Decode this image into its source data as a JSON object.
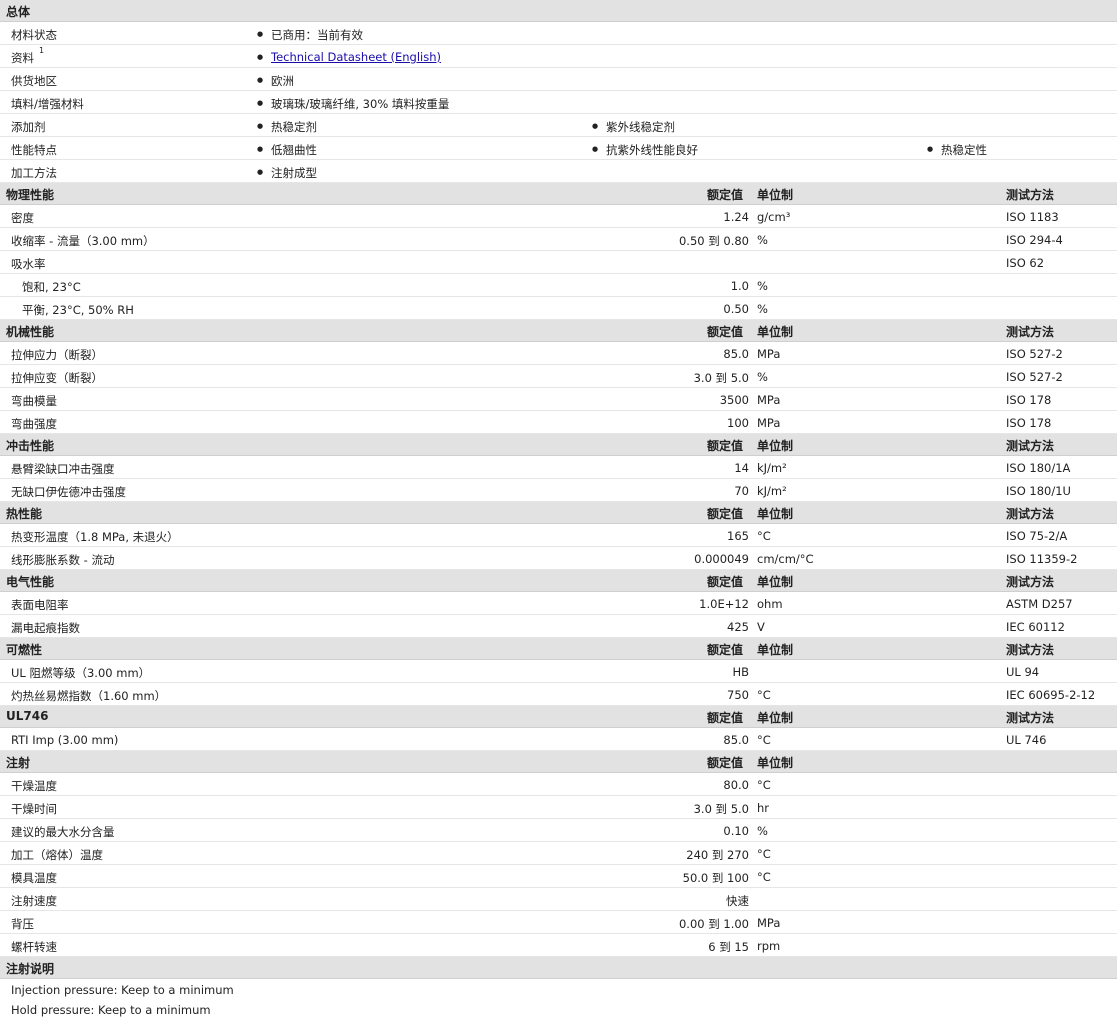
{
  "general": {
    "title": "总体",
    "rows": [
      {
        "label": "材料状态",
        "items": [
          "已商用：当前有效"
        ]
      },
      {
        "label": "资料",
        "sup": "1",
        "link": "Technical Datasheet (English)"
      },
      {
        "label": "供货地区",
        "items": [
          "欧洲"
        ]
      },
      {
        "label": "填料/增强材料",
        "items": [
          "玻璃珠/玻璃纤维, 30% 填料按重量"
        ]
      },
      {
        "label": "添加剂",
        "items": [
          "热稳定剂",
          "紫外线稳定剂"
        ]
      },
      {
        "label": "性能特点",
        "items": [
          "低翘曲性",
          "抗紫外线性能良好",
          "热稳定性"
        ]
      },
      {
        "label": "加工方法",
        "items": [
          "注射成型"
        ]
      }
    ]
  },
  "headers": {
    "value": "额定值",
    "unit": "单位制",
    "method": "测试方法"
  },
  "sections": [
    {
      "title": "物理性能",
      "show_method": true,
      "rows": [
        {
          "label": "密度",
          "value": "1.24",
          "unit": "g/cm³",
          "method": "ISO 1183"
        },
        {
          "label": "收缩率 - 流量（3.00 mm）",
          "value": "0.50 到  0.80",
          "unit": "%",
          "method": "ISO 294-4"
        },
        {
          "label": "吸水率",
          "value": "",
          "unit": "",
          "method": "ISO 62"
        },
        {
          "label": "饱和, 23°C",
          "sub": true,
          "value": "1.0",
          "unit": "%",
          "method": ""
        },
        {
          "label": "平衡, 23°C, 50% RH",
          "sub": true,
          "value": "0.50",
          "unit": "%",
          "method": ""
        }
      ]
    },
    {
      "title": "机械性能",
      "show_method": true,
      "rows": [
        {
          "label": "拉伸应力（断裂）",
          "value": "85.0",
          "unit": "MPa",
          "method": "ISO 527-2"
        },
        {
          "label": "拉伸应变（断裂）",
          "value": "3.0 到  5.0",
          "unit": "%",
          "method": "ISO 527-2"
        },
        {
          "label": "弯曲模量",
          "value": "3500",
          "unit": "MPa",
          "method": "ISO 178"
        },
        {
          "label": "弯曲强度",
          "value": "100",
          "unit": "MPa",
          "method": "ISO 178"
        }
      ]
    },
    {
      "title": "冲击性能",
      "show_method": true,
      "rows": [
        {
          "label": "悬臂梁缺口冲击强度",
          "value": "14",
          "unit": "kJ/m²",
          "method": "ISO 180/1A"
        },
        {
          "label": "无缺口伊佐德冲击强度",
          "value": "70",
          "unit": "kJ/m²",
          "method": "ISO 180/1U"
        }
      ]
    },
    {
      "title": "热性能",
      "show_method": true,
      "rows": [
        {
          "label": "热变形温度（1.8 MPa, 未退火）",
          "value": "165",
          "unit": "°C",
          "method": "ISO 75-2/A"
        },
        {
          "label": "线形膨胀系数 - 流动",
          "value": "0.000049",
          "unit": "cm/cm/°C",
          "method": "ISO 11359-2"
        }
      ]
    },
    {
      "title": "电气性能",
      "show_method": true,
      "rows": [
        {
          "label": "表面电阻率",
          "value": "1.0E+12",
          "unit": "ohm",
          "method": "ASTM D257"
        },
        {
          "label": "漏电起痕指数",
          "value": "425",
          "unit": "V",
          "method": "IEC 60112"
        }
      ]
    },
    {
      "title": "可燃性",
      "show_method": true,
      "rows": [
        {
          "label": "UL 阻燃等级（3.00 mm）",
          "value": "HB",
          "unit": "",
          "method": "UL 94"
        },
        {
          "label": "灼热丝易燃指数（1.60 mm）",
          "value": "750",
          "unit": "°C",
          "method": "IEC 60695-2-12"
        }
      ]
    },
    {
      "title": "UL746",
      "show_method": true,
      "rows": [
        {
          "label": "RTI Imp (3.00 mm)",
          "value": "85.0",
          "unit": "°C",
          "method": "UL 746"
        }
      ]
    },
    {
      "title": "注射",
      "show_method": false,
      "rows": [
        {
          "label": "干燥温度",
          "value": "80.0",
          "unit": "°C",
          "method": ""
        },
        {
          "label": "干燥时间",
          "value": "3.0 到  5.0",
          "unit": "hr",
          "method": ""
        },
        {
          "label": "建议的最大水分含量",
          "value": "0.10",
          "unit": "%",
          "method": ""
        },
        {
          "label": "加工（熔体）温度",
          "value": "240 到  270",
          "unit": "°C",
          "method": ""
        },
        {
          "label": "模具温度",
          "value": "50.0 到  100",
          "unit": "°C",
          "method": ""
        },
        {
          "label": "注射速度",
          "value": "快速",
          "unit": "",
          "method": ""
        },
        {
          "label": "背压",
          "value": "0.00 到  1.00",
          "unit": "MPa",
          "method": ""
        },
        {
          "label": "螺杆转速",
          "value": "6 到  15",
          "unit": "rpm",
          "method": ""
        }
      ]
    }
  ],
  "notes": {
    "title": "注射说明",
    "lines": [
      "Injection pressure: Keep to a minimum",
      "Hold pressure: Keep to a minimum"
    ]
  }
}
